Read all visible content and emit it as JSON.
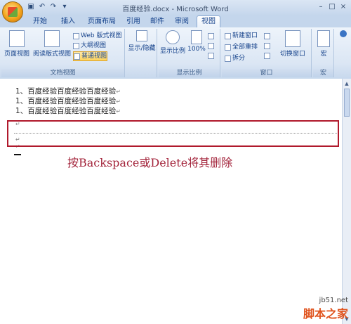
{
  "window": {
    "title": "百度经验.docx - Microsoft Word"
  },
  "quick_access": {
    "items": [
      "save-icon",
      "undo-icon",
      "redo-icon",
      "customize-icon"
    ]
  },
  "window_controls": {
    "minimize": "–",
    "maximize": "□",
    "close": "×"
  },
  "tabs": [
    "开始",
    "插入",
    "页面布局",
    "引用",
    "邮件",
    "审阅",
    "视图"
  ],
  "active_tab": "视图",
  "ribbon": {
    "doc_views": {
      "label": "文档视图",
      "page_view": "页面视图",
      "reading_view": "阅读版式视图",
      "web_view": "Web 版式视图",
      "outline_view": "大纲视图",
      "draft_view": "普通视图"
    },
    "show_hide": {
      "label": "显示/隐藏"
    },
    "zoom": {
      "label": "显示比例",
      "zoom_button": "显示比例",
      "percent": "100%"
    },
    "window_group": {
      "label": "窗口",
      "new_window": "新建窗口",
      "arrange_all": "全部重排",
      "split": "拆分",
      "switch_window": "切换窗口"
    },
    "macros": {
      "label": "宏",
      "button": "宏"
    }
  },
  "document": {
    "lines": [
      "1、百度经验百度经验百度经验",
      "1、百度经验百度经验百度经验",
      "1、百度经验百度经验百度经验"
    ],
    "paragraph_mark": "↵",
    "annotation": "按Backspace或Delete将其删除"
  },
  "watermark": {
    "site": "jb51.net",
    "brand": "脚本之家"
  },
  "colors": {
    "highlight_box": "#b0192c",
    "annotation_text": "#a3243b",
    "ribbon_bg": "#dbe6f4",
    "watermark_brand": "#e0531d"
  }
}
